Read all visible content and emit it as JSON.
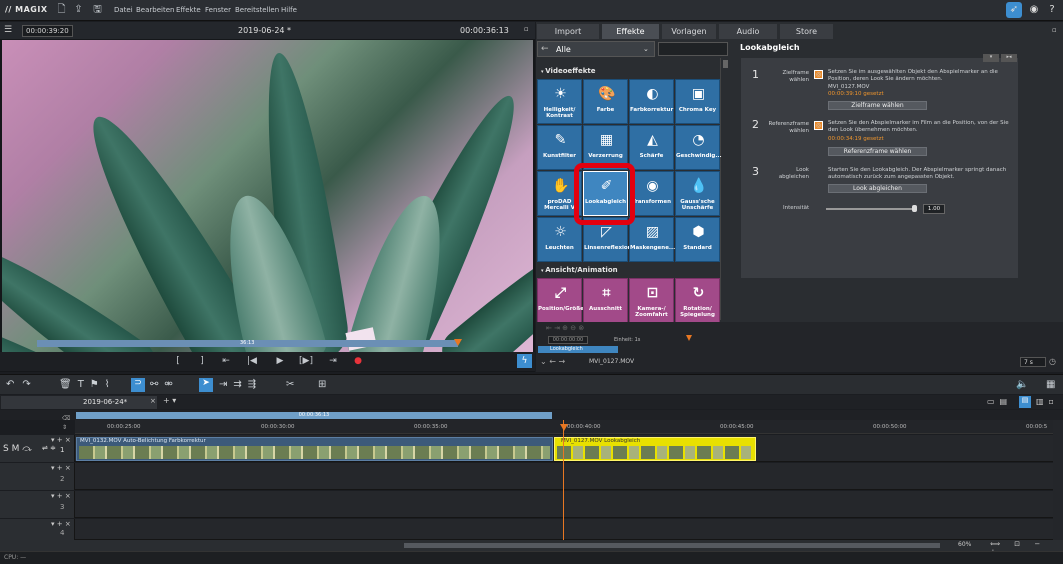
{
  "menubar": {
    "logo": "// MAGIX",
    "menus": [
      "Datei",
      "Bearbeiten",
      "Effekte",
      "Fenster",
      "Bereitstellen",
      "Hilfe"
    ]
  },
  "preview": {
    "timecode_left": "00:00:39:20",
    "title": "2019-06-24 *",
    "timecode_right": "00:00:36:13",
    "scrub_timecode": "36:13",
    "transport": [
      "[",
      "]",
      "⇤",
      "|◀",
      "▶",
      "[▶]",
      "⇥",
      "●"
    ]
  },
  "tabs": [
    "Import",
    "Effekte",
    "Vorlagen",
    "Audio",
    "Store"
  ],
  "active_tab": "Effekte",
  "category": "Alle",
  "sections": {
    "video": "Videoeffekte",
    "ansicht": "Ansicht/Animation"
  },
  "tiles_video": [
    {
      "label": "Helligkeit/\nKontrast",
      "icon": "☀"
    },
    {
      "label": "Farbe",
      "icon": "🎨"
    },
    {
      "label": "Farbkorrektur",
      "icon": "◐"
    },
    {
      "label": "Chroma Key",
      "icon": "▣"
    },
    {
      "label": "Kunstfilter",
      "icon": "✎"
    },
    {
      "label": "Verzerrung",
      "icon": "▦"
    },
    {
      "label": "Schärfe",
      "icon": "◭"
    },
    {
      "label": "Geschwindig...",
      "icon": "◔"
    },
    {
      "label": "proDAD\nMercalli V",
      "icon": "✋"
    },
    {
      "label": "Lookabgleich",
      "icon": "✐"
    },
    {
      "label": "Transformen",
      "icon": "◉"
    },
    {
      "label": "Gauss'sche\nUnschärfe",
      "icon": "💧"
    },
    {
      "label": "Leuchten",
      "icon": "☼"
    },
    {
      "label": "Linsenreflexion",
      "icon": "◸"
    },
    {
      "label": "Maskengene...",
      "icon": "▨"
    },
    {
      "label": "Standard",
      "icon": "⬢"
    }
  ],
  "tiles_ansicht": [
    {
      "label": "Position/Größe",
      "icon": "⤢"
    },
    {
      "label": "Ausschnitt",
      "icon": "⌗"
    },
    {
      "label": "Kamera-/\nZoomfahrt",
      "icon": "⊡"
    },
    {
      "label": "Rotation/\nSpiegelung",
      "icon": "↻"
    }
  ],
  "look": {
    "title": "Lookabgleich",
    "steps": [
      {
        "num": "1",
        "label": "Zielframe\nwählen",
        "text": "Setzen Sie im ausgewählten Objekt den Abspielmarker an die Position, deren Look Sie ändern möchten.",
        "file": "MVI_0127.MOV",
        "time": "00:00:39:10  gesetzt",
        "button": "Zielframe wählen"
      },
      {
        "num": "2",
        "label": "Referenzframe\nwählen",
        "text": "Setzen Sie den Abspielmarker im Film an die Position, von der Sie den Look übernehmen möchten.",
        "time": "00:00:34:19  gesetzt",
        "button": "Referenzframe wählen"
      },
      {
        "num": "3",
        "label": "Look\nabgleichen",
        "text": "Starten Sie den Lookabgleich. Der Abspielmarker springt danach automatisch zurück zum angepassten Objekt.",
        "button": "Look abgleichen"
      }
    ],
    "intensity_label": "Intensität",
    "intensity_value": "1.00"
  },
  "minitl": {
    "einheit": "Einheit: 1s",
    "tc": "00:00:00:00",
    "track_label": "Lookabgleich",
    "clip": "MVI_0127.MOV",
    "zoom": "7 s"
  },
  "timeline": {
    "project_tab": "2019-06-24*",
    "range_label": "00:00:36:13",
    "ticks": [
      "00:00:25:00",
      "00:00:30:00",
      "00:00:35:00",
      "00:00:40:00",
      "00:00:45:00",
      "00:00:50:00",
      "00:00:5"
    ],
    "clipA_label": "MVI_0132.MOV  Auto-Belichtung  Farbkorrektur",
    "clipB_label": "MVI_0127.MOV  Lookabgleich",
    "tracks": [
      "1",
      "2",
      "3",
      "4"
    ],
    "zoom": "60%"
  },
  "status": {
    "cpu": "CPU: —"
  }
}
